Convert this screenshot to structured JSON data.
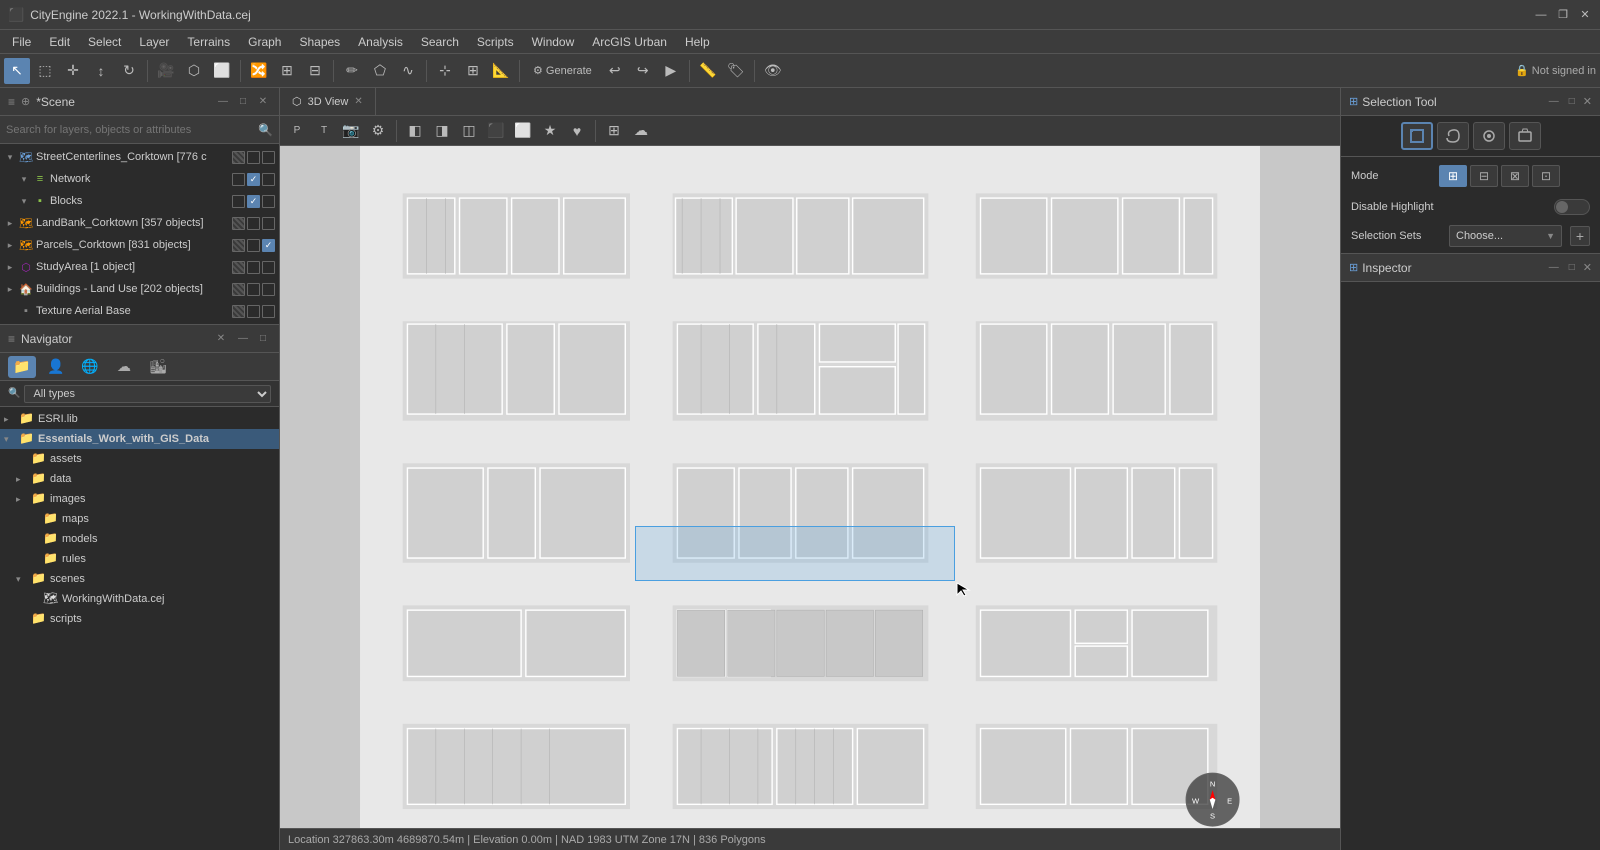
{
  "titlebar": {
    "title": "CityEngine 2022.1 - WorkingWithData.cej",
    "min": "—",
    "max": "❐",
    "close": "✕"
  },
  "menubar": {
    "items": [
      "File",
      "Edit",
      "Select",
      "Layer",
      "Terrains",
      "Graph",
      "Shapes",
      "Analysis",
      "Search",
      "Scripts",
      "Window",
      "ArcGIS Urban",
      "Help"
    ]
  },
  "scene": {
    "panel_title": "*Scene ✕",
    "search_placeholder": "Search for layers, objects or attributes",
    "layers": [
      {
        "indent": 0,
        "expand": "▾",
        "icon": "🗺",
        "type": "street",
        "name": "StreetCenterlines_Corktown [776 c",
        "cb1": "striped",
        "cb2": "",
        "cb3": ""
      },
      {
        "indent": 1,
        "expand": "▾",
        "icon": "≡",
        "type": "network",
        "name": "Network",
        "cb1": "",
        "cb2": "checked",
        "cb3": ""
      },
      {
        "indent": 1,
        "expand": "▾",
        "icon": "▪",
        "type": "blocks",
        "name": "Blocks",
        "cb1": "",
        "cb2": "checked",
        "cb3": ""
      },
      {
        "indent": 0,
        "expand": "▸",
        "icon": "🗺",
        "type": "landbank",
        "name": "LandBank_Corktown [357 objects]",
        "cb1": "striped",
        "cb2": "",
        "cb3": ""
      },
      {
        "indent": 0,
        "expand": "▸",
        "icon": "🗺",
        "type": "parcels",
        "name": "Parcels_Corktown [831 objects]",
        "cb1": "striped",
        "cb2": "",
        "cb3": "checked"
      },
      {
        "indent": 0,
        "expand": "▸",
        "icon": "⬡",
        "type": "study",
        "name": "StudyArea [1 object]",
        "cb1": "striped",
        "cb2": "",
        "cb3": ""
      },
      {
        "indent": 0,
        "expand": "▸",
        "icon": "🏠",
        "type": "buildings",
        "name": "Buildings - Land Use [202 objects]",
        "cb1": "striped",
        "cb2": "",
        "cb3": ""
      },
      {
        "indent": 0,
        "expand": "",
        "icon": "▪",
        "type": "texture",
        "name": "Texture Aerial Base",
        "cb1": "striped",
        "cb2": "",
        "cb3": ""
      }
    ]
  },
  "navigator": {
    "panel_title": "Navigator ✕",
    "filter_options": [
      "All types"
    ],
    "filter_selected": "All types",
    "tree": [
      {
        "indent": 0,
        "expand": "▸",
        "icon": "📁",
        "label": "ESRI.lib"
      },
      {
        "indent": 0,
        "expand": "▾",
        "icon": "📁",
        "label": "Essentials_Work_with_GIS_Data",
        "selected": true
      },
      {
        "indent": 1,
        "expand": "",
        "icon": "📁",
        "label": "assets"
      },
      {
        "indent": 1,
        "expand": "▸",
        "icon": "📁",
        "label": "data"
      },
      {
        "indent": 1,
        "expand": "▸",
        "icon": "📁",
        "label": "images"
      },
      {
        "indent": 2,
        "expand": "",
        "icon": "📁",
        "label": "maps"
      },
      {
        "indent": 2,
        "expand": "",
        "icon": "📁",
        "label": "models"
      },
      {
        "indent": 2,
        "expand": "",
        "icon": "📁",
        "label": "rules"
      },
      {
        "indent": 1,
        "expand": "▾",
        "icon": "📁",
        "label": "scenes"
      },
      {
        "indent": 2,
        "expand": "",
        "icon": "🗺",
        "label": "WorkingWithData.cej"
      },
      {
        "indent": 1,
        "expand": "",
        "icon": "📁",
        "label": "scripts"
      }
    ]
  },
  "viewport": {
    "tab_label": "3D View",
    "status": "Location 327863.30m 4689870.54m  |  Elevation 0.00m  |  NAD 1983 UTM Zone 17N  |  836 Polygons"
  },
  "right_panel": {
    "selection_tool": {
      "title": "Selection Tool",
      "mode_label": "Mode",
      "mode_buttons": [
        "▣",
        "⬡",
        "⬢",
        "⬣"
      ],
      "disable_highlight_label": "Disable Highlight",
      "selection_sets_label": "Selection Sets",
      "choose_text": "Choose...",
      "add_btn": "+"
    },
    "inspector": {
      "title": "Inspector"
    }
  },
  "not_signed": "🔒 Not signed in"
}
